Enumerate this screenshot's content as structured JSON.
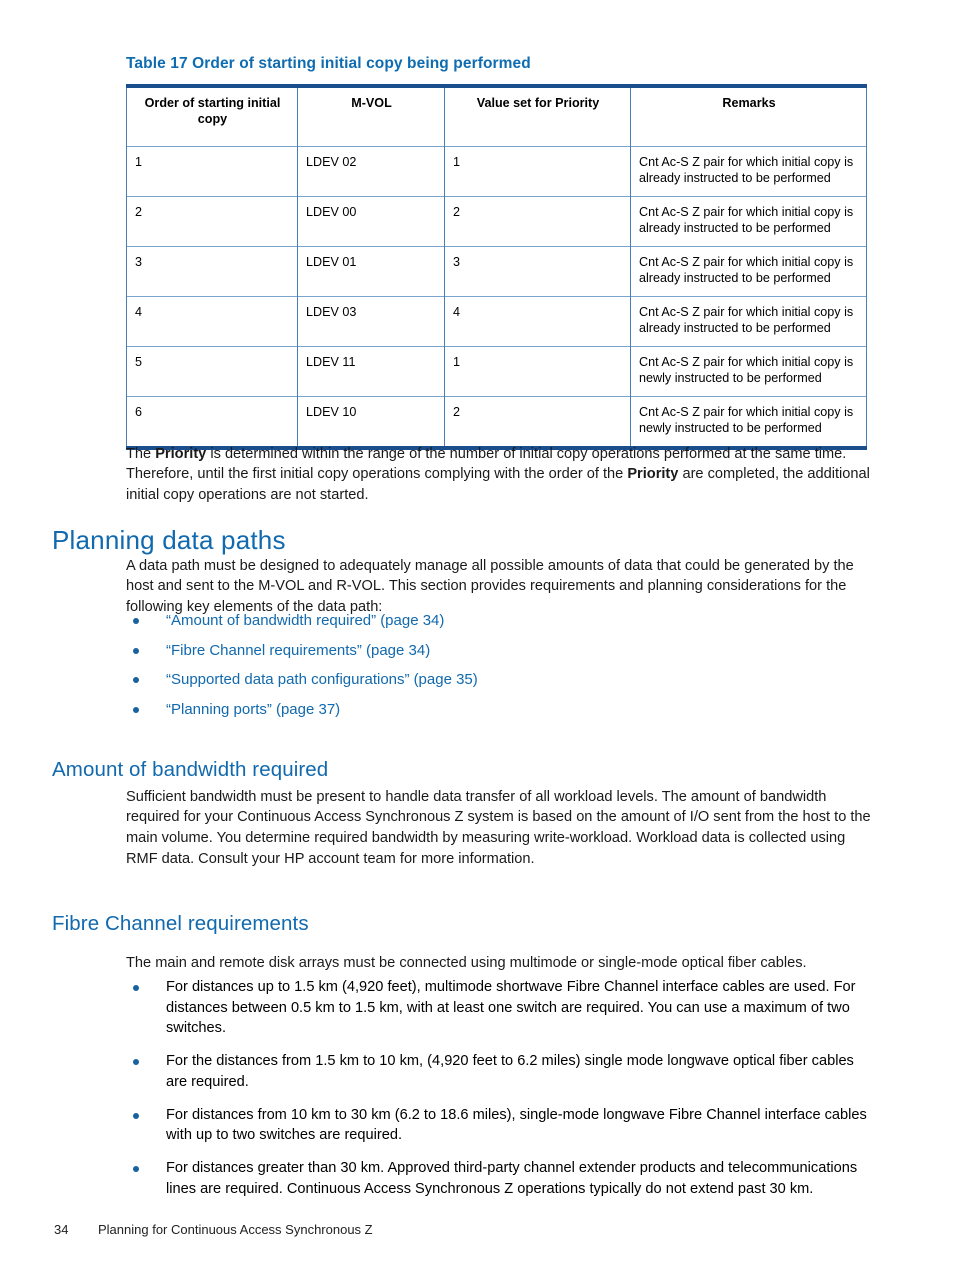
{
  "table": {
    "caption": "Table 17 Order of starting initial copy being performed",
    "headers": [
      "Order of starting initial copy",
      "M-VOL",
      "Value set for Priority",
      "Remarks"
    ],
    "rows": [
      [
        "1",
        "LDEV 02",
        "1",
        "Cnt Ac-S Z pair for which initial copy is already instructed to be performed"
      ],
      [
        "2",
        "LDEV 00",
        "2",
        "Cnt Ac-S Z pair for which initial copy is already instructed to be performed"
      ],
      [
        "3",
        "LDEV 01",
        "3",
        "Cnt Ac-S Z pair for which initial copy is already instructed to be performed"
      ],
      [
        "4",
        "LDEV 03",
        "4",
        "Cnt Ac-S Z pair for which initial copy is already instructed to be performed"
      ],
      [
        "5",
        "LDEV 11",
        "1",
        "Cnt Ac-S Z pair for which initial copy is newly instructed to be performed"
      ],
      [
        "6",
        "LDEV 10",
        "2",
        "Cnt Ac-S Z pair for which initial copy is newly instructed to be performed"
      ]
    ]
  },
  "priority_paragraph": {
    "part1": "The ",
    "bold1": "Priority",
    "part2": " is determined within the range of the number of initial copy operations performed at the same time. Therefore, until the first initial copy operations complying with the order of the ",
    "bold2": "Priority",
    "part3": " are completed, the additional initial copy operations are not started."
  },
  "sections": {
    "planning_data_paths": {
      "heading": "Planning data paths",
      "intro": "A data path must be designed to adequately manage all possible amounts of data that could be generated by the host and sent to the M-VOL and R-VOL. This section provides requirements and planning considerations for the following key elements of the data path:",
      "links": [
        {
          "title": "“Amount of bandwidth required”",
          "page": "(page 34)"
        },
        {
          "title": "“Fibre Channel requirements”",
          "page": "(page 34)"
        },
        {
          "title": "“Supported data path configurations”",
          "page": "(page 35)"
        },
        {
          "title": "“Planning ports”",
          "page": "(page 37)"
        }
      ]
    },
    "amount_of_bandwidth_required": {
      "heading": "Amount of bandwidth required",
      "body": "Sufficient bandwidth must be present to handle data transfer of all workload levels. The amount of bandwidth required for your Continuous Access Synchronous Z system is based on the amount of I/O sent from the host to the main volume. You determine required bandwidth by measuring write-workload. Workload data is collected using RMF data. Consult your HP account team for more information."
    },
    "fibre_channel_requirements": {
      "heading": "Fibre Channel requirements",
      "intro": "The main and remote disk arrays must be connected using multimode or single-mode optical fiber cables.",
      "bullets": [
        "For distances up to 1.5 km (4,920 feet), multimode shortwave Fibre Channel interface cables are used. For distances between 0.5 km to 1.5 km, with at least one switch are required. You can use a maximum of two switches.",
        "For the distances from 1.5 km to 10 km, (4,920 feet to 6.2 miles) single mode longwave optical fiber cables are required.",
        "For distances from 10 km to 30 km (6.2 to 18.6 miles), single-mode longwave Fibre Channel interface cables with up to two switches are required.",
        "For distances greater than 30 km. Approved third-party channel extender products and telecommunications lines are required. Continuous Access Synchronous Z operations typically do not extend past 30 km."
      ]
    }
  },
  "footer": {
    "page_number": "34",
    "chapter_title": "Planning for Continuous Access Synchronous Z"
  },
  "colors": {
    "heading_blue": "#1169ae",
    "caption_blue": "#0f6cb0",
    "table_rule_dark": "#1b4e8c",
    "table_rule_light": "#7ba3cc",
    "bullet_blue": "#18639f"
  }
}
